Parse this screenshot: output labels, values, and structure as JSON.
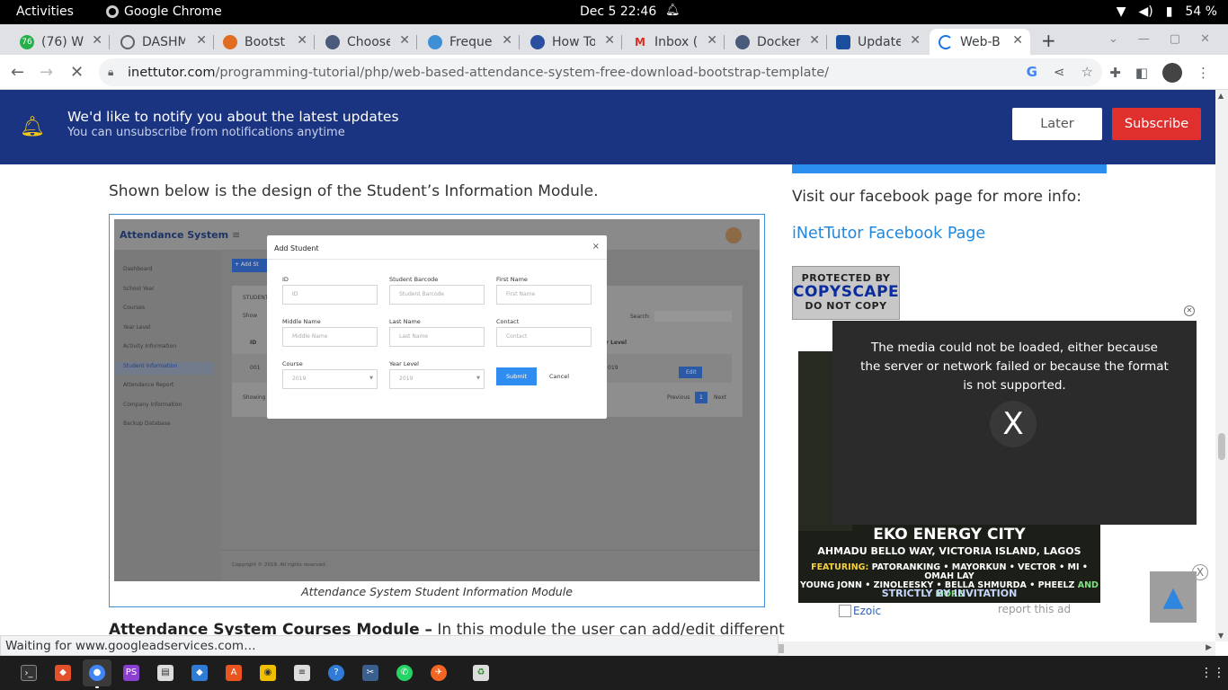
{
  "system": {
    "activities": "Activities",
    "app_name": "Google Chrome",
    "datetime": "Dec 5  22:46",
    "battery": "54 %"
  },
  "tabs": [
    {
      "title": "(76) Wh",
      "color": "#25b04a",
      "badge": "76"
    },
    {
      "title": "DASHM",
      "color": "#5f6368",
      "badge": ""
    },
    {
      "title": "Bootst",
      "color": "#e06c1f",
      "badge": ""
    },
    {
      "title": "Choose",
      "color": "#4a5a7a",
      "badge": ""
    },
    {
      "title": "Freque",
      "color": "#3d8fd6",
      "badge": ""
    },
    {
      "title": "How To",
      "color": "#2a4fa0",
      "badge": ""
    },
    {
      "title": "Inbox (",
      "color": "#d93025",
      "badge": "M"
    },
    {
      "title": "Docker",
      "color": "#4a5a7a",
      "badge": ""
    },
    {
      "title": "Update",
      "color": "#1a4fa0",
      "badge": ""
    },
    {
      "title": "Web-B",
      "color": "#1a73e8",
      "badge": ""
    }
  ],
  "address": {
    "domain": "inettutor.com",
    "path": "/programming-tutorial/php/web-based-attendance-system-free-download-bootstrap-template/"
  },
  "notification": {
    "title": "We'd like to notify you about the latest updates",
    "subtitle": "You can unsubscribe from notifications anytime",
    "later": "Later",
    "subscribe": "Subscribe"
  },
  "article": {
    "intro": "Shown below is the design of the Student’s Information Module.",
    "caption": "Attendance System Student Information Module",
    "para_bold": "Attendance System Courses Module –",
    "para_text": " In this module the user can add/edit different"
  },
  "screenshot": {
    "brand": "Attendance System",
    "sidebar": [
      "Dashboard",
      "School Year",
      "Courses",
      "Year Level",
      "Activity Information",
      "Student Information",
      "Attendance Report",
      "Company Information",
      "Backup Database"
    ],
    "add_btn": "+ Add St",
    "card_title": "STUDENT",
    "show": "Show",
    "search": "Search:",
    "col_id": "ID",
    "col_year": "ar Level",
    "row_id": "001",
    "row_year": "019",
    "edit": "Edit",
    "showing": "Showing",
    "prev": "Previous",
    "page": "1",
    "next": "Next",
    "copyright": "Copyright © 2019. All rights reserved.",
    "modal": {
      "title": "Add Student",
      "close": "×",
      "fields": [
        {
          "label": "ID",
          "placeholder": "ID"
        },
        {
          "label": "Student Barcode",
          "placeholder": "Student Barcode"
        },
        {
          "label": "First Name",
          "placeholder": "First Name"
        },
        {
          "label": "Middle Name",
          "placeholder": "Middle Name"
        },
        {
          "label": "Last Name",
          "placeholder": "Last Name"
        },
        {
          "label": "Contact",
          "placeholder": "Contact"
        },
        {
          "label": "Course",
          "placeholder": "2019"
        },
        {
          "label": "Year Level",
          "placeholder": "2019"
        }
      ],
      "submit": "Submit",
      "cancel": "Cancel"
    }
  },
  "sidebar": {
    "visit": "Visit our facebook page for more info:",
    "fb_link": "iNetTutor Facebook Page",
    "copyscape": [
      "PROTECTED BY",
      "COPYSCAPE",
      "DO NOT COPY"
    ]
  },
  "ad": {
    "headline": "EKO ENERGY CITY",
    "address": "AHMADU BELLO WAY, VICTORIA ISLAND, LAGOS",
    "featuring_label": "FEATURING:",
    "featuring_line1": " PATORANKING • MAYORKUN • VECTOR • MI • OMAH LAY",
    "featuring_line2": "YOUNG JONN • ZINOLEESKY • BELLA SHMURDA • PHEELZ ",
    "and_more": "AND MORE",
    "invite": "STRICTLY BY INVITATION",
    "ezoic": "Ezoic",
    "report": "report this ad"
  },
  "video": {
    "error": "The media could not be loaded, either because the server or network failed or because the format is not supported.",
    "x": "X"
  },
  "status_text": "Waiting for www.googleadservices.com…",
  "totop_close": "X"
}
